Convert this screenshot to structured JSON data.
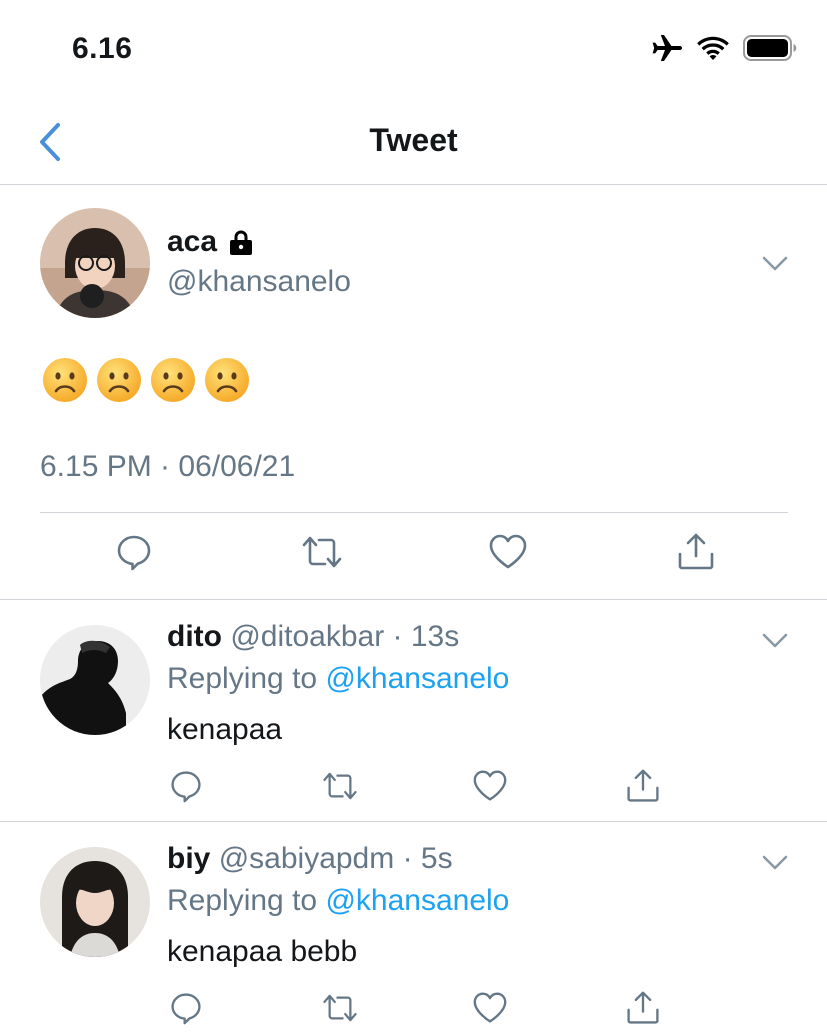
{
  "status_bar": {
    "time": "6.16"
  },
  "nav": {
    "title": "Tweet"
  },
  "main_tweet": {
    "name": "aca",
    "handle": "@khansanelo",
    "content_emojis": [
      "☹️",
      "☹️",
      "☹️",
      "☹️"
    ],
    "timestamp": "6.15 PM · 06/06/21"
  },
  "replies": [
    {
      "name": "dito",
      "handle": "@ditoakbar",
      "time": "· 13s",
      "replying_prefix": "Replying to ",
      "replying_to": "@khansanelo",
      "text": "kenapaa"
    },
    {
      "name": "biy",
      "handle": "@sabiyapdm",
      "time": "· 5s",
      "replying_prefix": "Replying to ",
      "replying_to": "@khansanelo",
      "text": "kenapaa bebb"
    }
  ],
  "colors": {
    "accent": "#4a90d9",
    "mention": "#1da1f2",
    "secondary_text": "#657786",
    "divider": "#d0d4d8"
  }
}
